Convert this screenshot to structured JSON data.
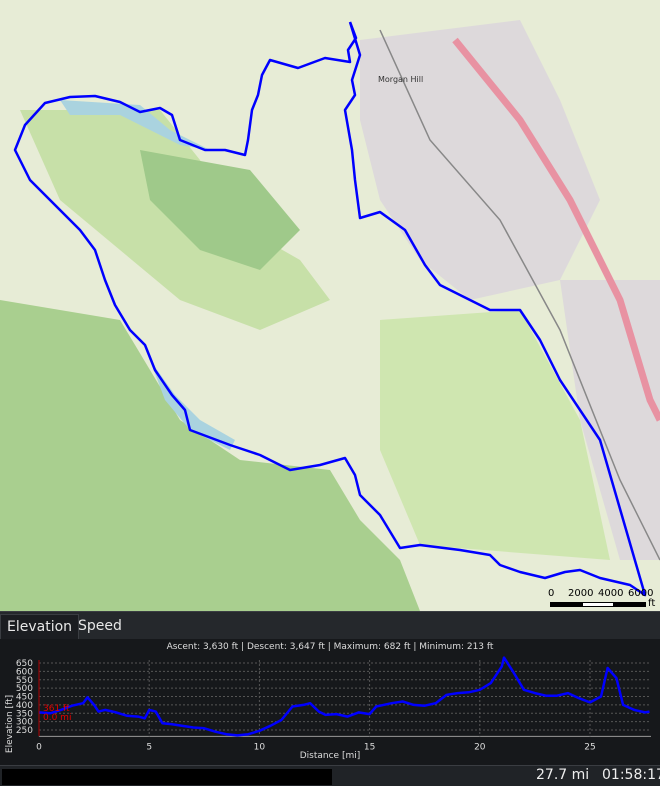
{
  "map": {
    "place_label": "Morgan Hill",
    "route_color": "#0000ff",
    "scale_bar": {
      "labels": [
        "0",
        "2000",
        "4000",
        "6000"
      ],
      "unit": "ft"
    }
  },
  "tabs": [
    {
      "label": "Elevation",
      "active": true
    },
    {
      "label": "Speed",
      "active": false
    }
  ],
  "stats": {
    "ascent": "Ascent: 3,630 ft",
    "descent": "Descent: 3,647 ft",
    "maximum": "Maximum: 682 ft",
    "minimum": "Minimum: 213 ft"
  },
  "chart_data": {
    "type": "line",
    "xlabel": "Distance [mi]",
    "ylabel": "Elevation [ft]",
    "xlim": [
      0,
      27.7
    ],
    "ylim": [
      200,
      680
    ],
    "xticks": [
      0,
      5,
      10,
      15,
      20,
      25
    ],
    "yticks": [
      250,
      300,
      350,
      400,
      450,
      500,
      550,
      600,
      650
    ],
    "grid": true,
    "series_color": "#0000ff",
    "cursor": {
      "elevation_label": "361 ft",
      "distance_label": "0.0 mi",
      "color": "#cc0000"
    },
    "x": [
      0,
      0.5,
      1,
      1.5,
      2,
      2.2,
      2.5,
      2.7,
      3,
      3.5,
      4,
      4.5,
      4.8,
      5,
      5.3,
      5.6,
      6,
      7,
      7.5,
      8,
      8.5,
      9,
      9.5,
      10,
      10.5,
      11,
      11.5,
      12,
      12.3,
      12.7,
      13,
      13.5,
      14,
      14.5,
      15,
      15.3,
      16,
      16.5,
      17,
      17.5,
      18,
      18.5,
      19,
      19.5,
      20,
      20.5,
      21,
      21.1,
      21.5,
      22,
      22.5,
      23,
      23.5,
      24,
      24.5,
      25,
      25.5,
      25.8,
      26.2,
      26.5,
      27,
      27.5,
      27.7
    ],
    "y": [
      355,
      350,
      370,
      395,
      410,
      445,
      400,
      360,
      370,
      355,
      335,
      330,
      320,
      370,
      360,
      290,
      285,
      265,
      260,
      240,
      225,
      218,
      225,
      245,
      275,
      310,
      390,
      400,
      410,
      360,
      340,
      345,
      330,
      355,
      345,
      390,
      410,
      420,
      400,
      395,
      410,
      460,
      470,
      475,
      490,
      530,
      630,
      682,
      600,
      490,
      470,
      455,
      455,
      470,
      440,
      415,
      450,
      620,
      560,
      400,
      370,
      355,
      360
    ]
  },
  "status": {
    "distance": "27.7 mi",
    "duration": "01:58:17"
  }
}
